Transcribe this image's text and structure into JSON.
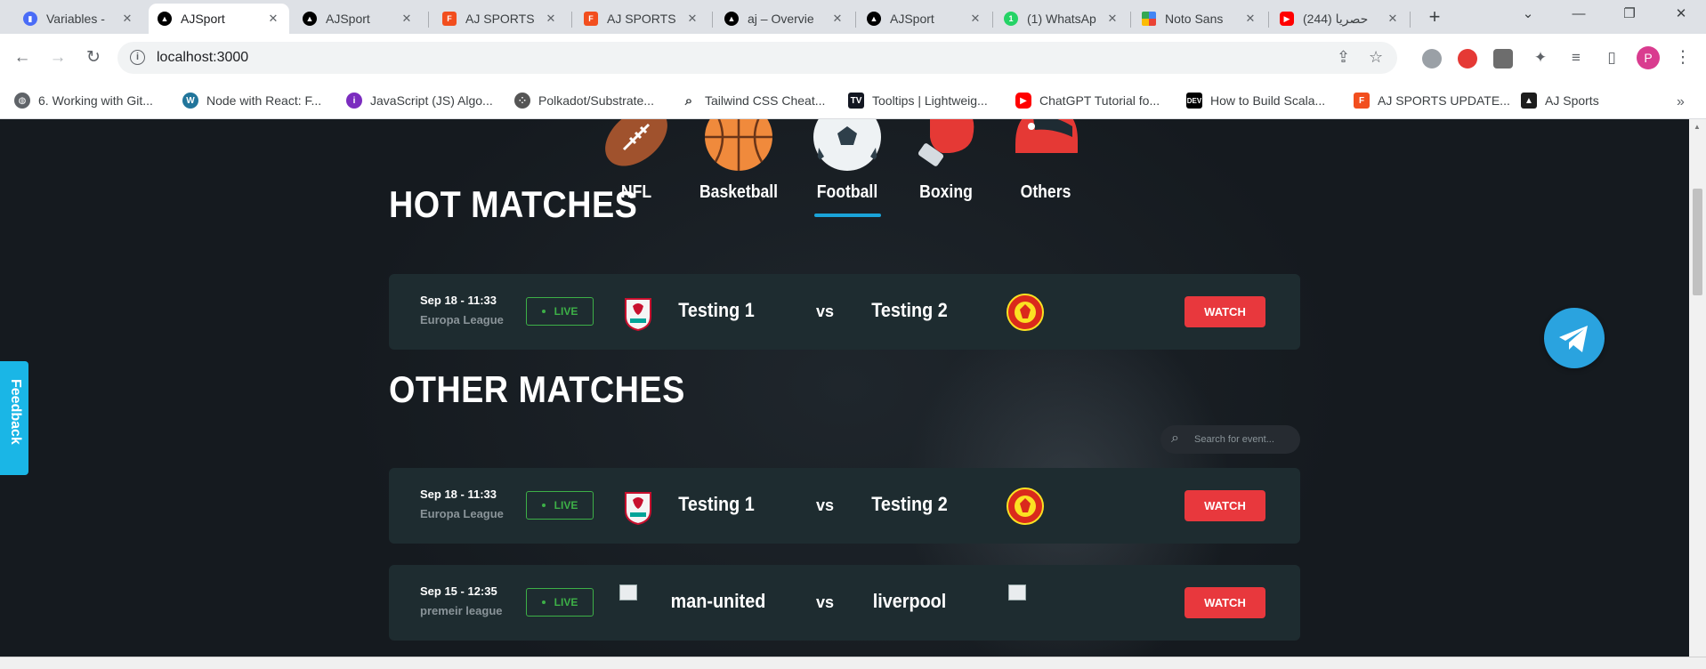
{
  "browser": {
    "tabs": [
      {
        "title": "Variables - ",
        "icon": "figma-variables-icon",
        "color": "#4a6cf7",
        "active": false
      },
      {
        "title": "AJSport",
        "icon": "vercel-icon",
        "color": "#000000",
        "active": true
      },
      {
        "title": "AJSport",
        "icon": "vercel-icon",
        "color": "#000000",
        "active": false
      },
      {
        "title": "AJ SPORTS",
        "icon": "figma-icon",
        "color": "#f24e1e",
        "active": false
      },
      {
        "title": "AJ SPORTS",
        "icon": "figma-icon",
        "color": "#f24e1e",
        "active": false
      },
      {
        "title": "aj – Overvie",
        "icon": "vercel-icon",
        "color": "#000000",
        "active": false
      },
      {
        "title": "AJSport",
        "icon": "vercel-icon",
        "color": "#000000",
        "active": false
      },
      {
        "title": "(1) WhatsAp",
        "icon": "whatsapp-icon",
        "color": "#25d366",
        "active": false
      },
      {
        "title": "Noto Sans",
        "icon": "google-fonts-icon",
        "color": "#4285f4",
        "active": false
      },
      {
        "title": "(244) حصريا",
        "icon": "youtube-icon",
        "color": "#ff0000",
        "active": false
      }
    ],
    "url": "localhost:3000",
    "profile_initial": "P",
    "bookmarks": [
      {
        "label": "6. Working with Git...",
        "icon": "globe-icon",
        "color": "#5f6368"
      },
      {
        "label": "Node with React: F...",
        "icon": "wordpress-icon",
        "color": "#21759b"
      },
      {
        "label": "JavaScript (JS) Algo...",
        "icon": "purple-logo-icon",
        "color": "#7b2cbf"
      },
      {
        "label": "Polkadot/Substrate...",
        "icon": "polkadot-icon",
        "color": "#555555"
      },
      {
        "label": "Tailwind CSS Cheat...",
        "icon": "search-icon",
        "color": "#3c4043"
      },
      {
        "label": "Tooltips | Lightweig...",
        "icon": "tradingview-icon",
        "color": "#131722"
      },
      {
        "label": "ChatGPT Tutorial fo...",
        "icon": "youtube-icon",
        "color": "#ff0000"
      },
      {
        "label": "How to Build Scala...",
        "icon": "dev-icon",
        "color": "#000000"
      },
      {
        "label": "AJ SPORTS UPDATE...",
        "icon": "figma-icon",
        "color": "#f24e1e"
      },
      {
        "label": "AJ Sports",
        "icon": "vercel-icon",
        "color": "#1d1d1d"
      }
    ]
  },
  "categories": [
    {
      "label": "NFL",
      "icon": "american-football-icon",
      "color": "#a0522d"
    },
    {
      "label": "Basketball",
      "icon": "basketball-icon",
      "color": "#f08a3c"
    },
    {
      "label": "Football",
      "icon": "soccer-ball-icon",
      "color": "#eef2f4",
      "active": true
    },
    {
      "label": "Boxing",
      "icon": "boxing-glove-icon",
      "color": "#e53935"
    },
    {
      "label": "Others",
      "icon": "racing-helmet-icon",
      "color": "#e53935"
    }
  ],
  "hot_matches": {
    "title": "HOT MATCHES",
    "items": [
      {
        "date": "Sep 18 - 11:33",
        "league": "Europa League",
        "status": "LIVE",
        "home": "Testing 1",
        "away": "Testing 2",
        "home_crest": "liverpool-crest-icon",
        "away_crest": "man-united-crest-icon",
        "watch": "WATCH"
      }
    ]
  },
  "other_matches": {
    "title": "OTHER MATCHES",
    "search_placeholder": "Search for event...",
    "items": [
      {
        "date": "Sep 18 - 11:33",
        "league": "Europa League",
        "status": "LIVE",
        "home": "Testing 1",
        "away": "Testing 2",
        "home_crest": "liverpool-crest-icon",
        "away_crest": "man-united-crest-icon",
        "watch": "WATCH"
      },
      {
        "date": "Sep 15 - 12:35",
        "league": "premeir league",
        "status": "LIVE",
        "home": "man-united",
        "away": "liverpool",
        "home_crest": "broken-image-icon",
        "away_crest": "broken-image-icon",
        "watch": "WATCH"
      }
    ]
  },
  "feedback_label": "Feedback",
  "vs_label": "vs",
  "colors": {
    "accent": "#1aa3d9",
    "live": "#3db047",
    "watch": "#e8383d",
    "card": "#1e2c30",
    "telegram": "#2aa3df"
  }
}
